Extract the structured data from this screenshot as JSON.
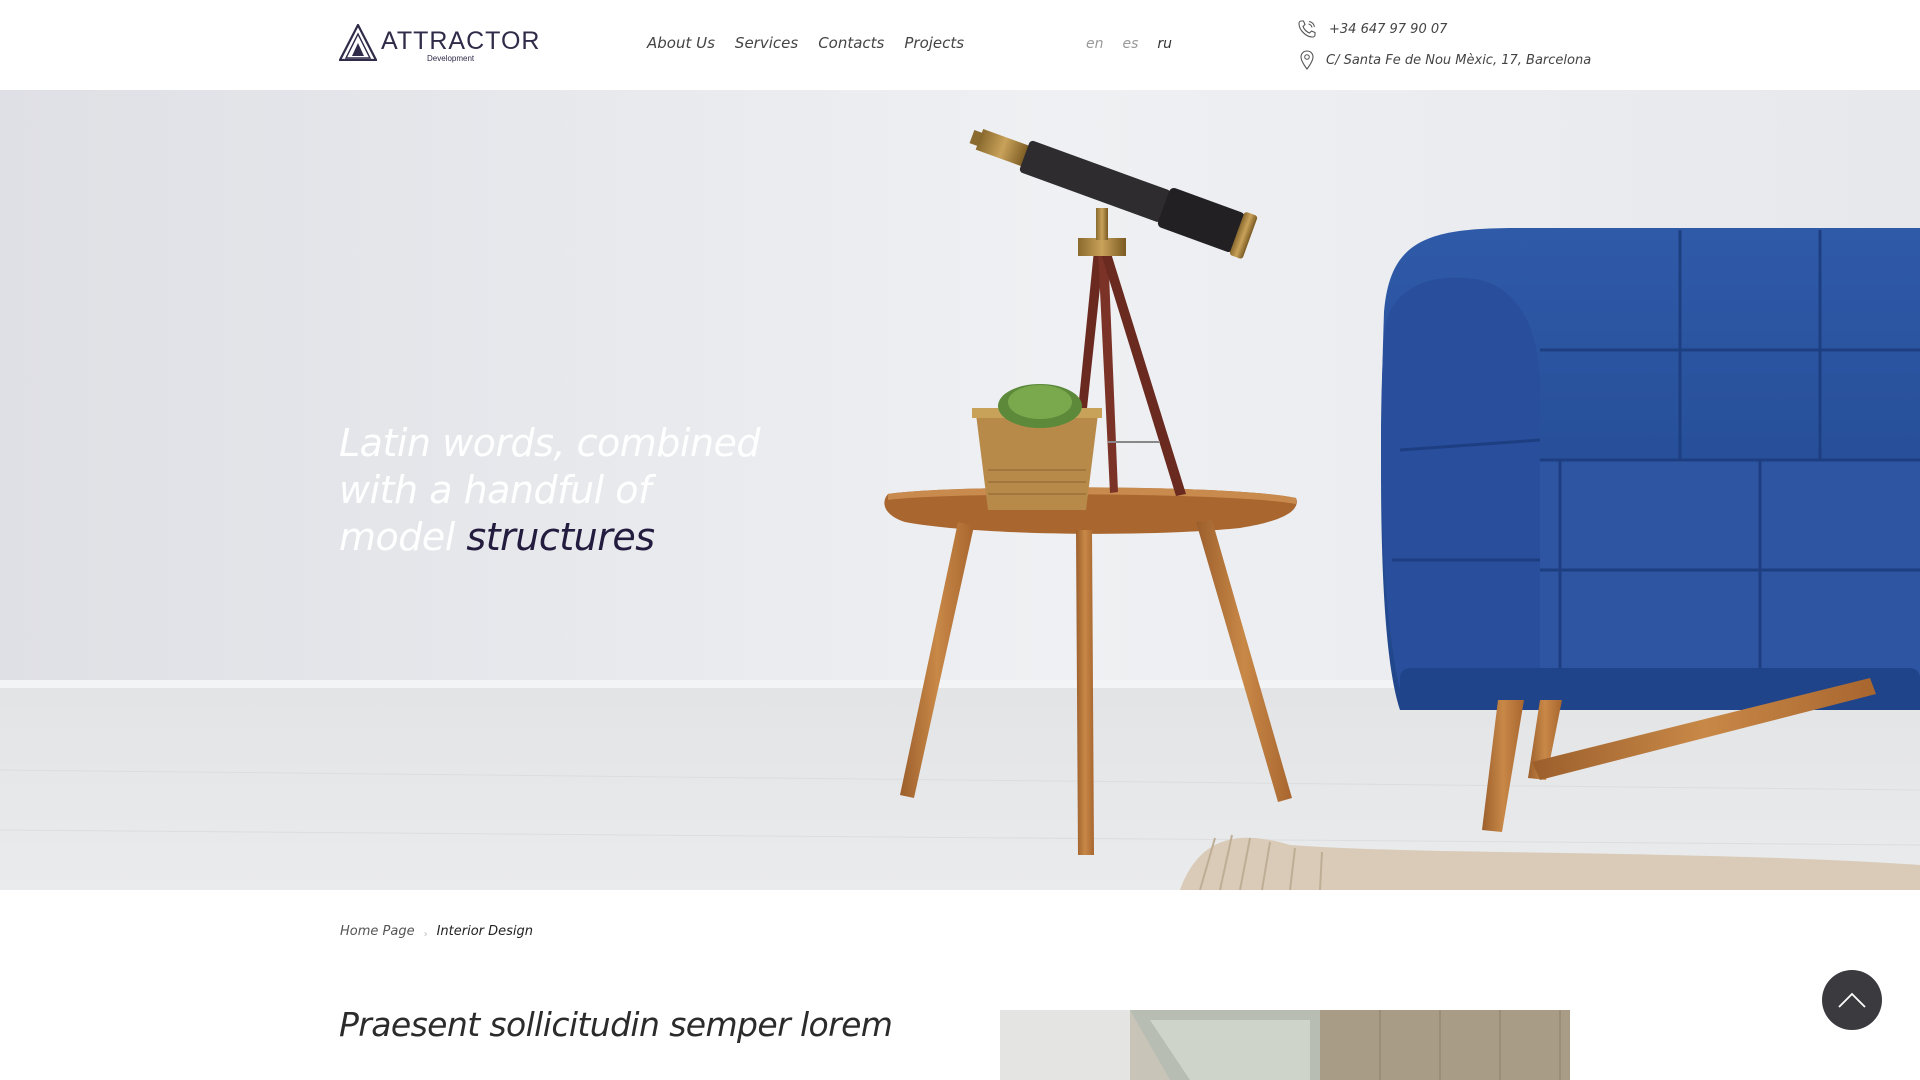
{
  "header": {
    "logo": {
      "name": "ATTRACTOR",
      "subtitle": "Development"
    },
    "nav": [
      {
        "label": "About Us"
      },
      {
        "label": "Services"
      },
      {
        "label": "Contacts"
      },
      {
        "label": "Projects"
      }
    ],
    "languages": [
      {
        "code": "en",
        "active": false
      },
      {
        "code": "es",
        "active": false
      },
      {
        "code": "ru",
        "active": true
      }
    ],
    "contact": {
      "phone": "+34 647 97 90 07",
      "address": "C/ Santa Fe de Nou Mèxic, 17, Barcelona",
      "phone_icon": "phone-icon",
      "address_icon": "location-pin-icon"
    }
  },
  "hero": {
    "title_plain": "Latin words, combined with a handful of model",
    "title_accent": "structures"
  },
  "breadcrumb": {
    "home": "Home Page",
    "current": "Interior Design"
  },
  "content": {
    "heading": "Praesent sollicitudin semper lorem"
  },
  "scroll_top": {
    "icon": "chevron-up-icon"
  },
  "colors": {
    "brand": "#2f2b48",
    "accent_dark": "#241c3f",
    "sofa_blue": "#2a4f9c",
    "scroll_button": "#3a3a3f"
  }
}
